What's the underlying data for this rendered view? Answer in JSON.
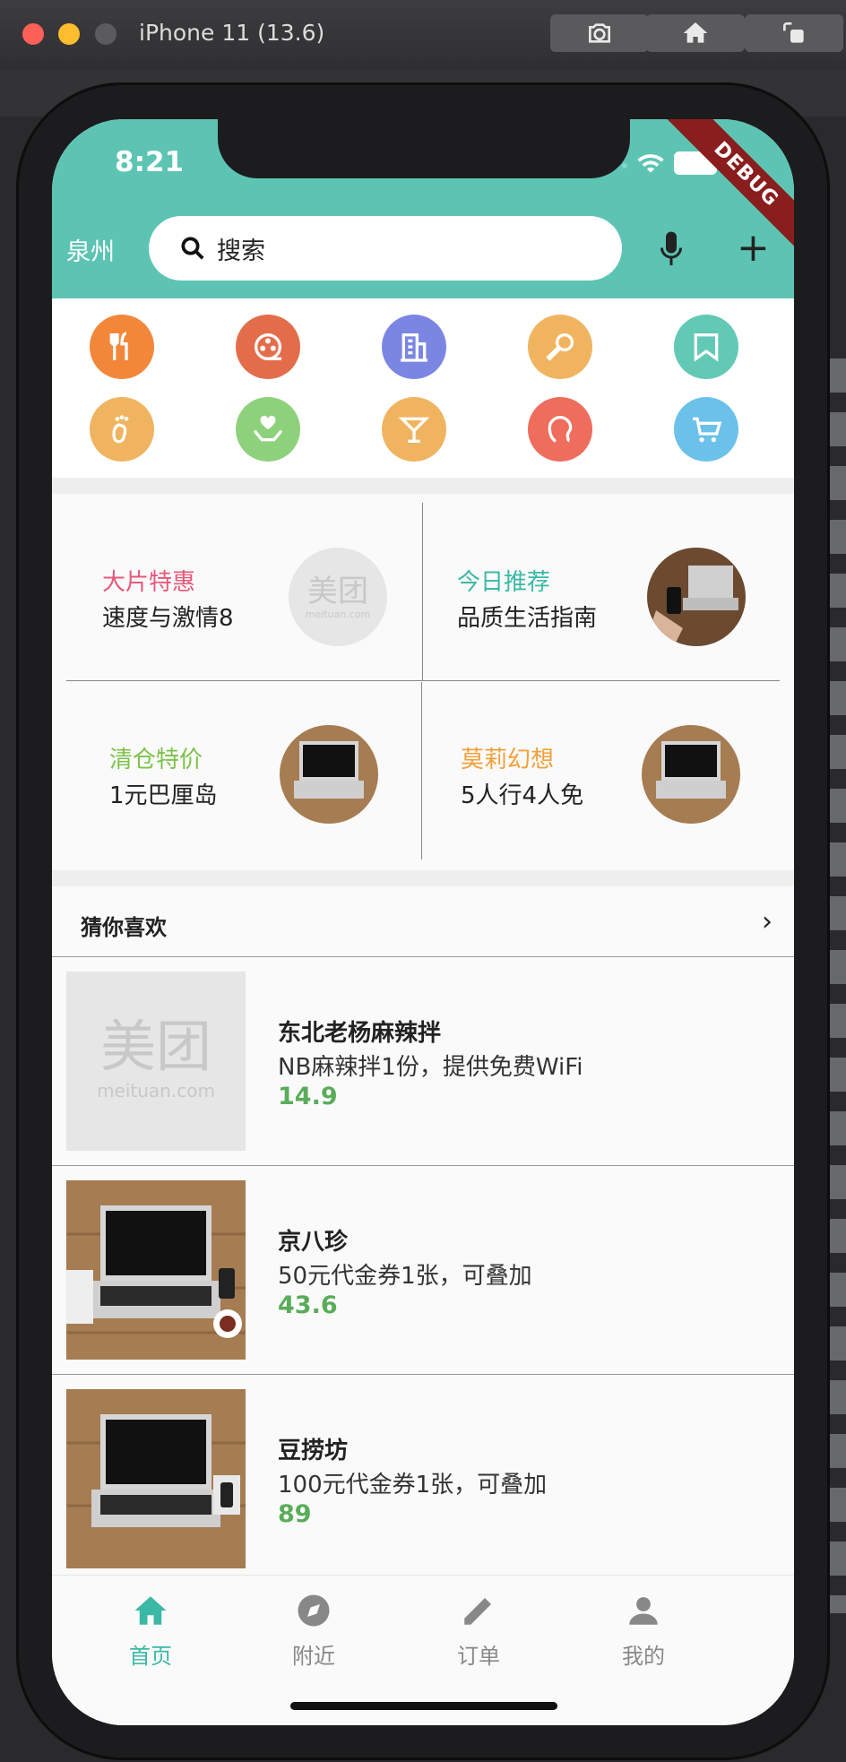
{
  "simulator": {
    "title": "iPhone 11 (13.6)"
  },
  "status": {
    "time": "8:21",
    "debug_banner": "DEBUG"
  },
  "header": {
    "city": "泉州",
    "search_placeholder": "搜索"
  },
  "menu_icons": [
    {
      "icon": "utensils-icon",
      "color": "#f2873a"
    },
    {
      "icon": "film-reel-icon",
      "color": "#e36d4a"
    },
    {
      "icon": "building-icon",
      "color": "#7b86e3"
    },
    {
      "icon": "microphone-icon",
      "color": "#f0b460"
    },
    {
      "icon": "bookmark-icon",
      "color": "#62c9b5"
    },
    {
      "icon": "footprint-icon",
      "color": "#f0b460"
    },
    {
      "icon": "heart-hands-icon",
      "color": "#8ed17c"
    },
    {
      "icon": "cocktail-icon",
      "color": "#f0b460"
    },
    {
      "icon": "face-profile-icon",
      "color": "#ee6d5c"
    },
    {
      "icon": "cart-icon",
      "color": "#6bc1ea"
    }
  ],
  "promos": [
    {
      "title": "大片特惠",
      "subtitle": "速度与激情8",
      "title_color": "#e8587a",
      "image": "meituan-logo"
    },
    {
      "title": "今日推荐",
      "subtitle": "品质生活指南",
      "title_color": "#3bb9a6",
      "image": "phone-laptop-photo"
    },
    {
      "title": "清仓特价",
      "subtitle": "1元巴厘岛",
      "title_color": "#7cc24a",
      "image": "laptop-photo"
    },
    {
      "title": "莫莉幻想",
      "subtitle": "5人行4人免",
      "title_color": "#f2a03a",
      "image": "laptop-photo"
    }
  ],
  "guess_section": {
    "title": "猜你喜欢"
  },
  "items": [
    {
      "name": "东北老杨麻辣拌",
      "desc": "NB麻辣拌1份，提供免费WiFi",
      "price": "14.9",
      "image": "meituan-logo"
    },
    {
      "name": "京八珍",
      "desc": "50元代金券1张，可叠加",
      "price": "43.6",
      "image": "laptop-photo"
    },
    {
      "name": "豆捞坊",
      "desc": "100元代金券1张，可叠加",
      "price": "89",
      "image": "laptop-photo"
    }
  ],
  "tabs": [
    {
      "label": "首页",
      "icon": "home-icon",
      "active": true
    },
    {
      "label": "附近",
      "icon": "compass-icon",
      "active": false
    },
    {
      "label": "订单",
      "icon": "pencil-icon",
      "active": false
    },
    {
      "label": "我的",
      "icon": "person-icon",
      "active": false
    }
  ],
  "colors": {
    "accent": "#5dc4b3",
    "price": "#5aac5a",
    "tab_active": "#3bb9a6",
    "tab_inactive": "#888888"
  }
}
